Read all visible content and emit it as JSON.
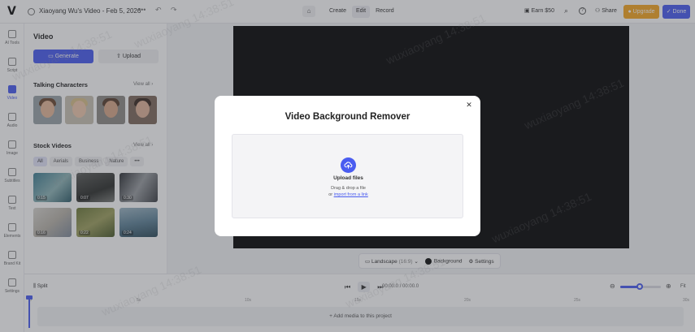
{
  "topbar": {
    "logo": "V",
    "project_title": "Xiaoyang Wu's Video - Feb 5, 2026",
    "more": "•••",
    "undo": "↶",
    "redo": "↷",
    "home": "⌂",
    "tabs": [
      {
        "label": "Create",
        "active": false
      },
      {
        "label": "Edit",
        "active": true
      },
      {
        "label": "Record",
        "active": false
      }
    ],
    "earn": "Earn $50",
    "search": "⌕",
    "help": "?",
    "share": "Share",
    "upgrade": "Upgrade",
    "done": "Done",
    "accent_color": "#4a5cf0",
    "upgrade_color": "#f5a623"
  },
  "rail": [
    {
      "label": "AI Tools",
      "active": false
    },
    {
      "label": "Script",
      "active": false
    },
    {
      "label": "Video",
      "active": true
    },
    {
      "label": "Audio",
      "active": false
    },
    {
      "label": "Image",
      "active": false
    },
    {
      "label": "Subtitles",
      "active": false
    },
    {
      "label": "Text",
      "active": false
    },
    {
      "label": "Elements",
      "active": false
    },
    {
      "label": "Brand Kit",
      "active": false
    },
    {
      "label": "Settings",
      "active": false
    }
  ],
  "panel": {
    "title": "Video",
    "generate": "Generate",
    "upload": "Upload",
    "talking_title": "Talking Characters",
    "talking_view_all": "View all",
    "stock_title": "Stock Videos",
    "stock_view_all": "View all",
    "filters": [
      {
        "label": "All",
        "active": true
      },
      {
        "label": "Aerials",
        "active": false
      },
      {
        "label": "Business",
        "active": false
      },
      {
        "label": "Nature",
        "active": false
      },
      {
        "label": "•••",
        "active": false
      }
    ],
    "stock_durations": [
      "0:15",
      "0:07",
      "0:30",
      "0:16",
      "0:22",
      "0:24"
    ]
  },
  "stage": {
    "aspect": "Landscape",
    "aspect_ratio": "(16:9)",
    "background": "Background",
    "settings": "Settings"
  },
  "timeline": {
    "split": "Split",
    "current_time": "00:00.0",
    "separator": "/",
    "total_time": "00:00.0",
    "fit": "Fit",
    "zoom_level": 0.48,
    "ruler_ticks": [
      "0",
      "5s",
      "10s",
      "15s",
      "20s",
      "25s",
      "30s"
    ],
    "add_media": "+ Add media to this project"
  },
  "modal": {
    "title": "Video Background Remover",
    "upload_title": "Upload files",
    "drag_drop": "Drag & drop a file",
    "or": "or",
    "import_link": "import from a link",
    "close": "✕"
  },
  "watermark": "wuxiaoyang 14:38:51"
}
